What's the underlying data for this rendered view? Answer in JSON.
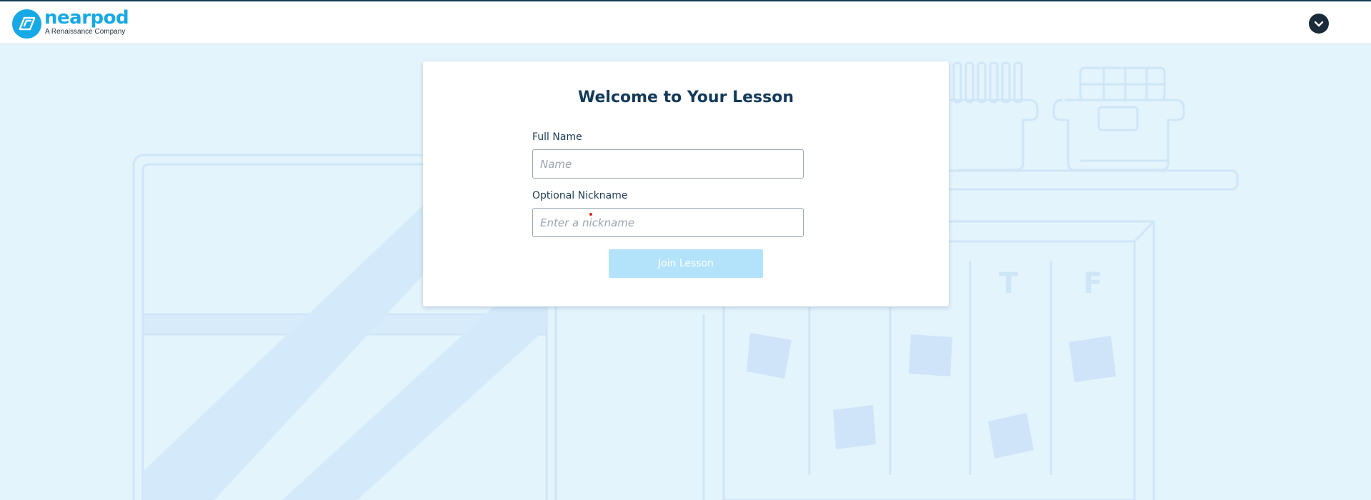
{
  "header": {
    "logo_word": "nearpod",
    "logo_subtitle": "A Renaissance Company",
    "logo_icon": "nearpod-logo-icon",
    "account_icon": "chevron-down-icon"
  },
  "form": {
    "title": "Welcome to Your Lesson",
    "full_name_label": "Full Name",
    "full_name_placeholder": "Name",
    "full_name_value": "",
    "nickname_label": "Optional Nickname",
    "nickname_placeholder": "Enter a nickname",
    "nickname_value": "",
    "join_label": "Join Lesson"
  },
  "background": {
    "calendar_letters": [
      "T",
      "F"
    ]
  },
  "colors": {
    "brand": "#16a9e6",
    "background": "#e3f4fd",
    "button_disabled": "#b3e3fb",
    "title": "#143a5a"
  }
}
